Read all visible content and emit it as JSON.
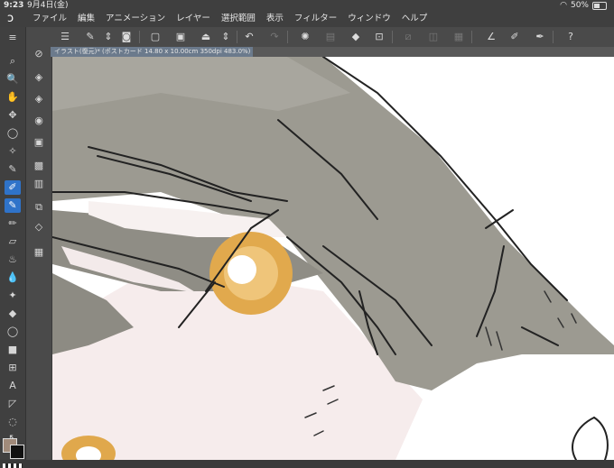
{
  "status": {
    "time": "9:23",
    "date": "9月4日(金)",
    "battery": "50%"
  },
  "menu": {
    "items": [
      "ファイル",
      "編集",
      "アニメーション",
      "レイヤー",
      "選択範囲",
      "表示",
      "フィルター",
      "ウィンドウ",
      "ヘルプ"
    ]
  },
  "tab": {
    "title": "イラスト(復元)* (ポストカード 14.80 x 10.00cm 350dpi 483.0%)"
  },
  "colors": {
    "main": "#a08a7a",
    "sub": "#111111",
    "accent": "#2f73c9"
  }
}
